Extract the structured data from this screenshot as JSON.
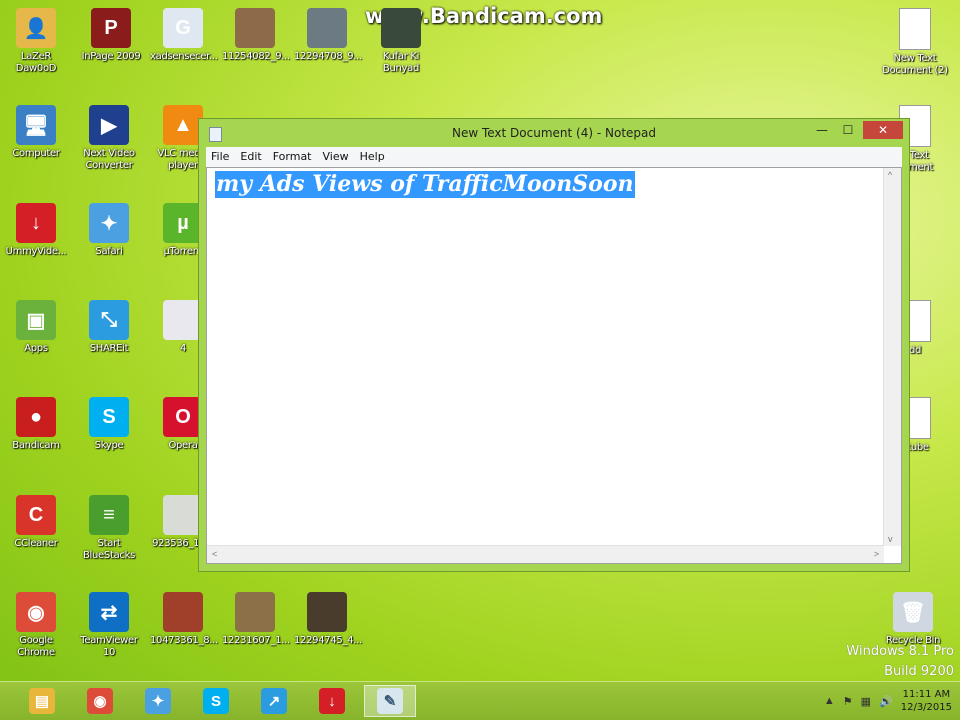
{
  "watermark": "www.Bandicam.com",
  "desktop_icons": [
    {
      "label": "LaZeR\nDaw0oD",
      "color": "#e6b84a",
      "glyph": "👤",
      "icon": "user-folder-icon"
    },
    {
      "label": "InPage 2009",
      "color": "#8a1c1c",
      "glyph": "P",
      "icon": "inpage-icon"
    },
    {
      "label": "xadsensecer...",
      "color": "#dfe8f0",
      "glyph": "G",
      "icon": "adsense-image-icon"
    },
    {
      "label": "11254082_9...",
      "color": "#8c6a4a",
      "glyph": "",
      "icon": "photo-thumbnail-icon"
    },
    {
      "label": "12294708_9...",
      "color": "#6c7a84",
      "glyph": "",
      "icon": "photo-thumbnail-icon"
    },
    {
      "label": "Kufar Ki\nBunyad",
      "color": "#3a4a3a",
      "glyph": "",
      "icon": "video-thumbnail-icon"
    },
    {
      "label": "Computer",
      "color": "#3b7fc4",
      "glyph": "🖥",
      "icon": "computer-icon"
    },
    {
      "label": "Next Video\nConverter",
      "color": "#1f3f8f",
      "glyph": "▶",
      "icon": "converter-icon"
    },
    {
      "label": "VLC media\nplayer",
      "color": "#f08a12",
      "glyph": "▲",
      "icon": "vlc-icon"
    },
    {
      "label": "UmmyVide...",
      "color": "#d41f26",
      "glyph": "↓",
      "icon": "ummy-video-icon"
    },
    {
      "label": "Safari",
      "color": "#4aa0e0",
      "glyph": "✦",
      "icon": "safari-icon"
    },
    {
      "label": "µTorrent",
      "color": "#5bb52a",
      "glyph": "µ",
      "icon": "utorrent-icon"
    },
    {
      "label": "Apps",
      "color": "#6ab23c",
      "glyph": "▣",
      "icon": "android-apps-icon"
    },
    {
      "label": "SHAREit",
      "color": "#2c9ce0",
      "glyph": "⤡",
      "icon": "shareit-icon"
    },
    {
      "label": "4",
      "color": "#e8e8ee",
      "glyph": "",
      "icon": "screenshot-thumbnail-icon"
    },
    {
      "label": "Bandicam",
      "color": "#c81e1e",
      "glyph": "●",
      "icon": "bandicam-icon"
    },
    {
      "label": "Skype",
      "color": "#00aff0",
      "glyph": "S",
      "icon": "skype-icon"
    },
    {
      "label": "Opera",
      "color": "#d6112d",
      "glyph": "O",
      "icon": "opera-icon"
    },
    {
      "label": "CCleaner",
      "color": "#d9342a",
      "glyph": "C",
      "icon": "ccleaner-icon"
    },
    {
      "label": "Start\nBlueStacks",
      "color": "#4a9e2e",
      "glyph": "≡",
      "icon": "bluestacks-icon"
    },
    {
      "label": "923536_10...",
      "color": "#d9dcd6",
      "glyph": "",
      "icon": "photo-thumbnail-icon"
    },
    {
      "label": "Google\nChrome",
      "color": "#dd4b39",
      "glyph": "◉",
      "icon": "chrome-icon"
    },
    {
      "label": "TeamViewer\n10",
      "color": "#0e6fc4",
      "glyph": "⇄",
      "icon": "teamviewer-icon"
    },
    {
      "label": "10473361_8...",
      "color": "#a0402a",
      "glyph": "",
      "icon": "photo-thumbnail-icon"
    },
    {
      "label": "12231607_1...",
      "color": "#8c7048",
      "glyph": "",
      "icon": "photo-thumbnail-icon"
    },
    {
      "label": "12294745_4...",
      "color": "#4a3c2c",
      "glyph": "",
      "icon": "photo-thumbnail-icon"
    },
    {
      "label": "New Text\nDocument (2)",
      "color": "#ffffff",
      "glyph": "",
      "icon": "text-document-icon"
    },
    {
      "label": "y Text\ncument",
      "color": "#ffffff",
      "glyph": "",
      "icon": "text-document-icon"
    },
    {
      "label": "dd",
      "color": "#ffffff",
      "glyph": "",
      "icon": "text-document-icon"
    },
    {
      "label": "utube",
      "color": "#ffffff",
      "glyph": "",
      "icon": "text-document-icon"
    },
    {
      "label": "Recycle Bin",
      "color": "#cfd8e0",
      "glyph": "🗑",
      "icon": "recycle-bin-icon"
    }
  ],
  "notepad": {
    "title": "New Text Document (4) - Notepad",
    "menu": [
      "File",
      "Edit",
      "Format",
      "View",
      "Help"
    ],
    "content": "my Ads Views of TrafficMoonSoon"
  },
  "windows_brand": {
    "line1": "Windows 8.1 Pro",
    "line2": "Build 9200"
  },
  "taskbar": {
    "apps": [
      {
        "name": "file-explorer",
        "color": "#e8b63a",
        "glyph": "▤"
      },
      {
        "name": "chrome",
        "color": "#dd4b39",
        "glyph": "◉"
      },
      {
        "name": "safari",
        "color": "#4aa0e0",
        "glyph": "✦"
      },
      {
        "name": "skype",
        "color": "#00aff0",
        "glyph": "S"
      },
      {
        "name": "shareit",
        "color": "#2c9ce0",
        "glyph": "↗"
      },
      {
        "name": "ummy-video",
        "color": "#d41f26",
        "glyph": "↓"
      },
      {
        "name": "notepad",
        "color": "#d8e6ee",
        "glyph": "✎"
      }
    ],
    "clock_time": "11:11 AM",
    "clock_date": "12/3/2015"
  }
}
